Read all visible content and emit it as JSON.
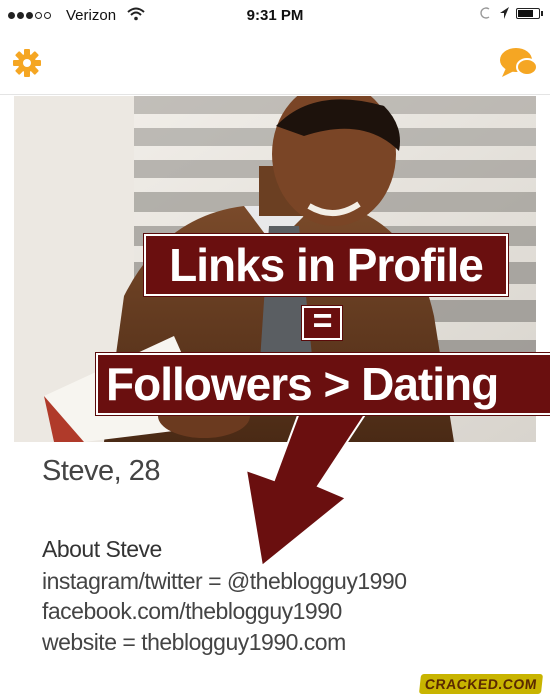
{
  "status_bar": {
    "carrier": "Verizon",
    "time": "9:31 PM",
    "signal_bars_filled": 3,
    "signal_bars_total": 5,
    "battery_level": 0.8
  },
  "header": {
    "settings_icon": "gear-icon",
    "chat_icon": "chat-bubble-icon",
    "accent_color": "#f5a623"
  },
  "overlay": {
    "links_text": "Links in Profile",
    "equals_text": "=",
    "followers_dating_text": "Followers > Dating",
    "banner_color": "#6a0f0f"
  },
  "profile": {
    "name_age": "Steve, 28",
    "about_heading": "About Steve",
    "line1": "instagram/twitter = @theblogguy1990",
    "line2": "facebook.com/theblogguy1990",
    "line3": "website = theblogguy1990.com"
  },
  "watermark": {
    "text": "CRACKED.COM"
  }
}
